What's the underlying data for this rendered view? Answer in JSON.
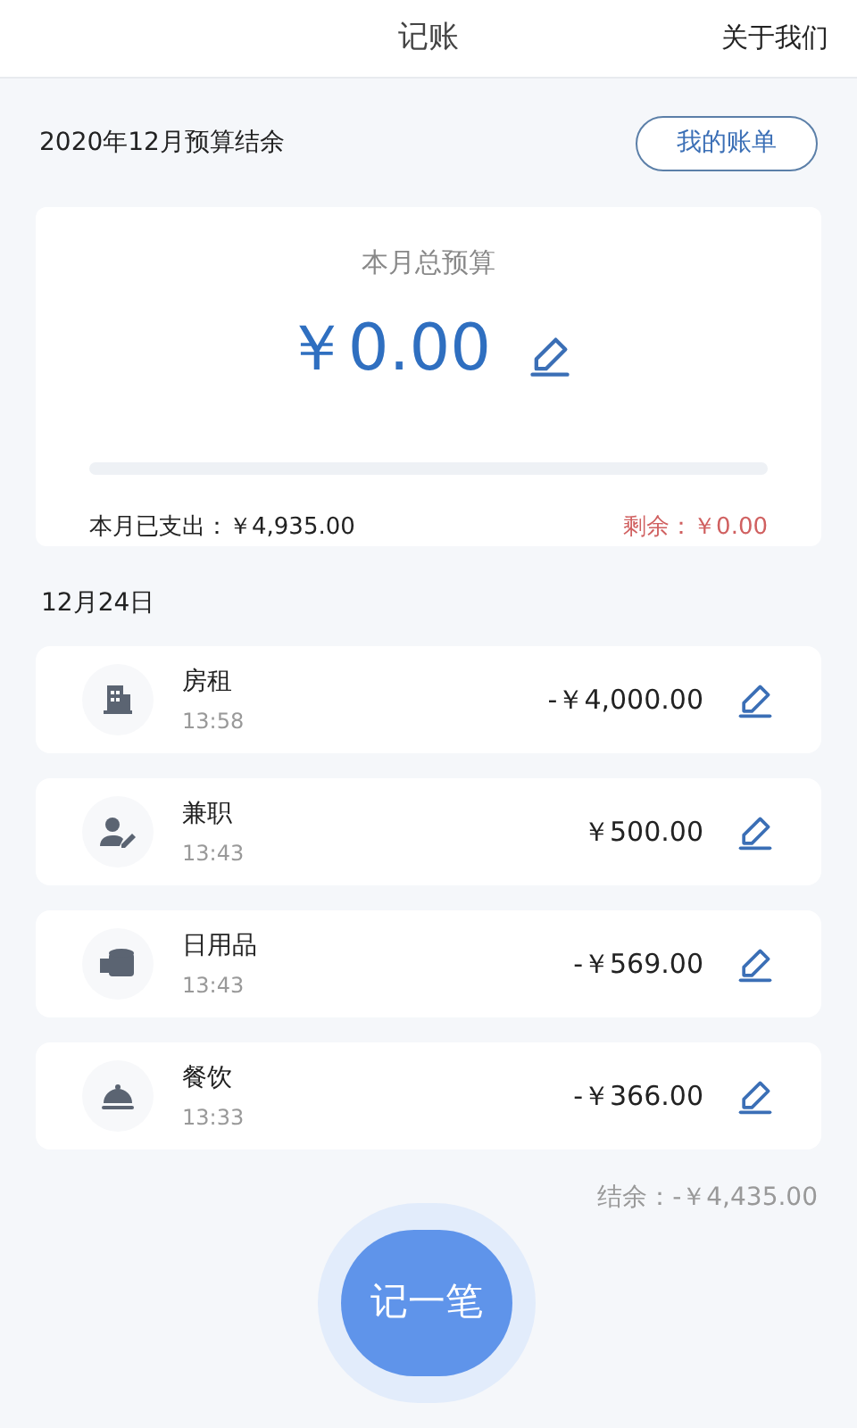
{
  "header": {
    "title": "记账",
    "about_link": "关于我们"
  },
  "budget_heading": "2020年12月预算结余",
  "bills_button": "我的账单",
  "budget_card": {
    "label": "本月总预算",
    "amount": "￥0.00",
    "level": 0,
    "spent": "本月已支出：￥4,935.00",
    "remaining": "剩余：￥0.00"
  },
  "date": "12月24日",
  "entries": [
    {
      "kind": "building",
      "name": "房租",
      "time": "13:58",
      "amount": "-￥4,000.00"
    },
    {
      "kind": "person",
      "name": "兼职",
      "time": "13:43",
      "amount": "￥500.00"
    },
    {
      "kind": "roll",
      "name": "日用品",
      "time": "13:43",
      "amount": "-￥569.00"
    },
    {
      "kind": "cloche",
      "name": "餐饮",
      "time": "13:33",
      "amount": "-￥366.00"
    }
  ],
  "balance": "结余：-￥4,435.00",
  "add_button": "记一笔"
}
